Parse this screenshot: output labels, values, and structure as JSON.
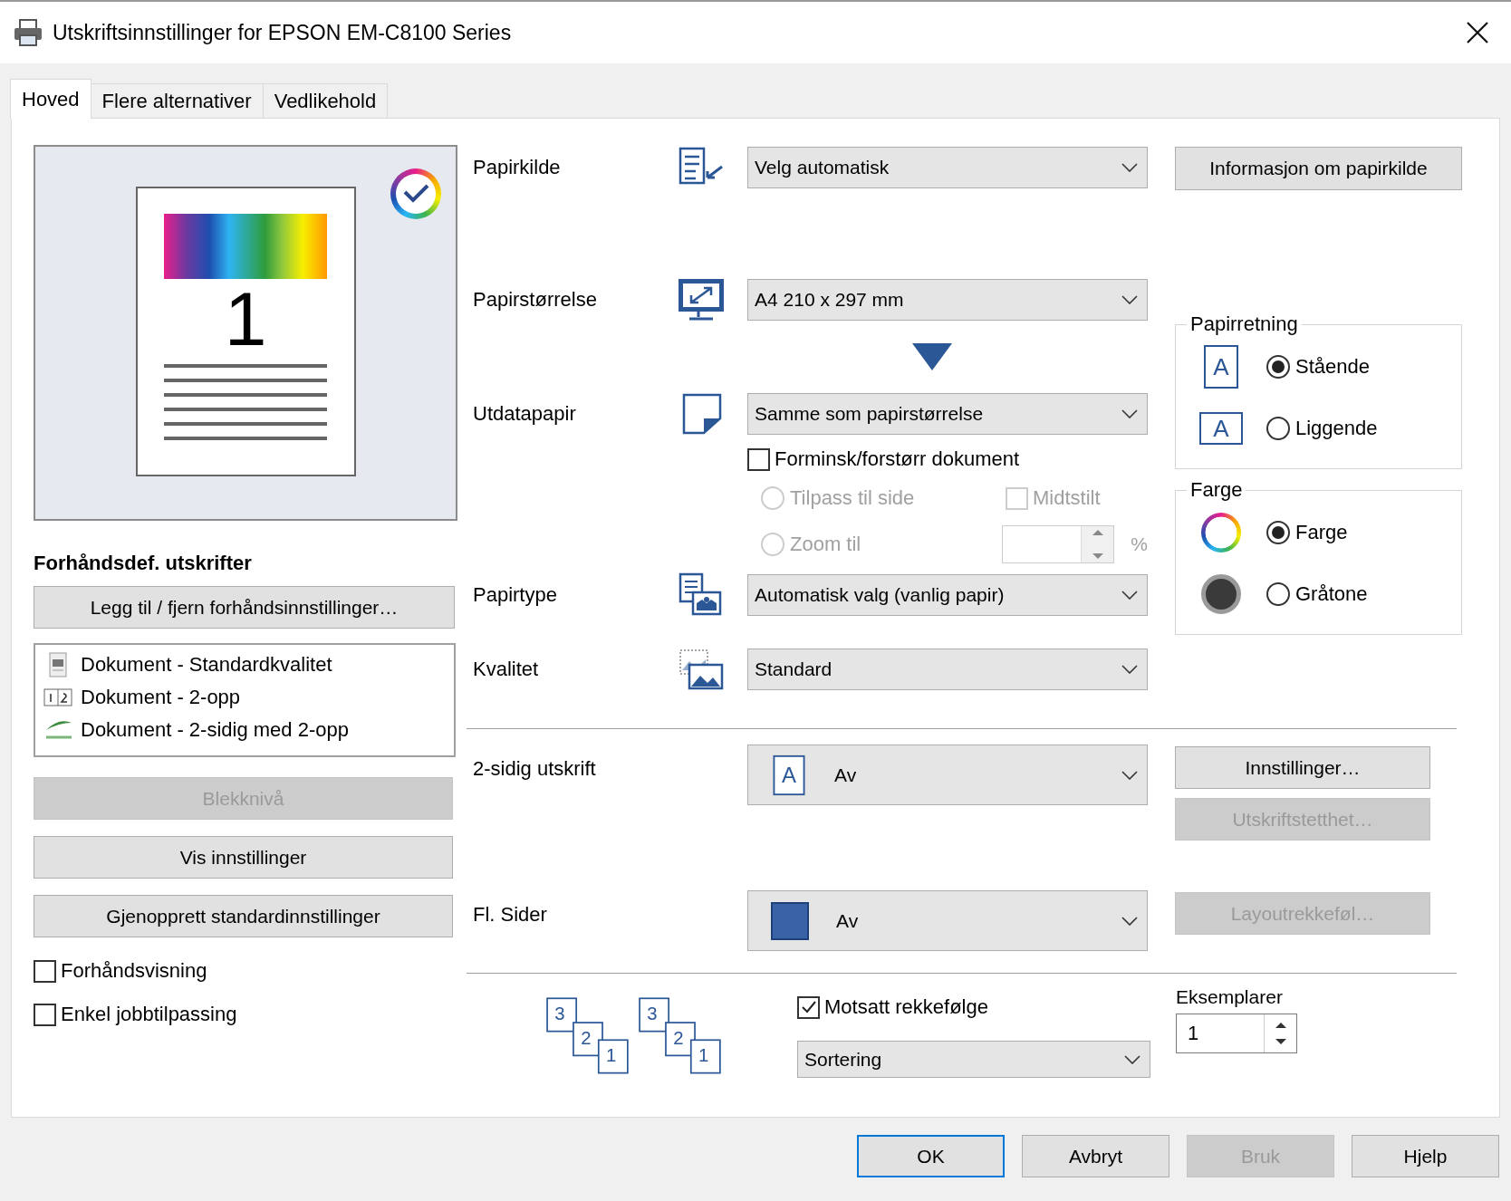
{
  "window": {
    "title": "Utskriftsinnstillinger for EPSON EM-C8100 Series"
  },
  "tabs": [
    {
      "label": "Hoved",
      "selected": true
    },
    {
      "label": "Flere alternativer",
      "selected": false
    },
    {
      "label": "Vedlikehold",
      "selected": false
    }
  ],
  "preview": {
    "page_number": "1"
  },
  "presets": {
    "title": "Forhåndsdef. utskrifter",
    "manage_button": "Legg til / fjern forhåndsinnstillinger…",
    "items": [
      {
        "label": "Dokument - Standardkvalitet",
        "kind": "standard"
      },
      {
        "label": "Dokument - 2-opp",
        "kind": "two-up"
      },
      {
        "label": "Dokument - 2-sidig med 2-opp",
        "kind": "eco"
      }
    ]
  },
  "left_buttons": [
    {
      "label": "Blekknivå",
      "disabled": true
    },
    {
      "label": "Vis innstillinger",
      "disabled": false
    },
    {
      "label": "Gjenopprett standardinnstillinger",
      "disabled": false
    }
  ],
  "left_checks": [
    {
      "label": "Forhåndsvisning",
      "checked": false
    },
    {
      "label": "Enkel jobbtilpassing",
      "checked": false
    }
  ],
  "paper_source": {
    "label": "Papirkilde",
    "value": "Velg automatisk",
    "button": "Informasjon om papirkilde"
  },
  "paper_size": {
    "label": "Papirstørrelse",
    "value": "A4 210 x 297 mm"
  },
  "output_paper": {
    "label": "Utdatapapir",
    "value": "Samme som papirstørrelse",
    "scale": {
      "label": "Forminsk/forstørr dokument",
      "checked": false
    },
    "fit": {
      "label": "Tilpass til side",
      "selected": false,
      "disabled": true
    },
    "center": {
      "label": "Midtstilt",
      "checked": false,
      "disabled": true
    },
    "zoom": {
      "label": "Zoom til",
      "selected": false,
      "disabled": true
    },
    "zoom_unit": "%"
  },
  "paper_type": {
    "label": "Papirtype",
    "value": "Automatisk valg (vanlig papir)"
  },
  "quality": {
    "label": "Kvalitet",
    "value": "Standard"
  },
  "orientation": {
    "title": "Papirretning",
    "options": [
      {
        "label": "Stående",
        "kind": "portrait",
        "icon_text": "A",
        "selected": true
      },
      {
        "label": "Liggende",
        "kind": "landscape",
        "icon_text": "A",
        "selected": false
      }
    ]
  },
  "color": {
    "title": "Farge",
    "options": [
      {
        "label": "Farge",
        "kind": "color",
        "selected": true
      },
      {
        "label": "Gråtone",
        "kind": "grayscale",
        "selected": false
      }
    ]
  },
  "duplex": {
    "label": "2-sidig utskrift",
    "icon_text": "A",
    "value": "Av",
    "buttons": [
      {
        "label": "Innstillinger…",
        "disabled": false
      },
      {
        "label": "Utskriftstetthet…",
        "disabled": true
      }
    ]
  },
  "multipage": {
    "label": "Fl. Sider",
    "value": "Av",
    "buttons": [
      {
        "label": "Layoutrekkeføl…",
        "disabled": true
      }
    ]
  },
  "collation_icons": [
    {
      "pages": [
        "3",
        "2",
        "1"
      ]
    },
    {
      "pages": [
        "3",
        "2",
        "1"
      ]
    }
  ],
  "reverse_order": {
    "label": "Motsatt rekkefølge",
    "checked": true
  },
  "collation": {
    "value": "Sortering"
  },
  "copies": {
    "label": "Eksemplarer",
    "value": "1"
  },
  "dialog_buttons": [
    {
      "label": "OK",
      "default": true,
      "disabled": false
    },
    {
      "label": "Avbryt",
      "default": false,
      "disabled": false
    },
    {
      "label": "Bruk",
      "default": false,
      "disabled": true
    },
    {
      "label": "Hjelp",
      "default": false,
      "disabled": false
    }
  ]
}
